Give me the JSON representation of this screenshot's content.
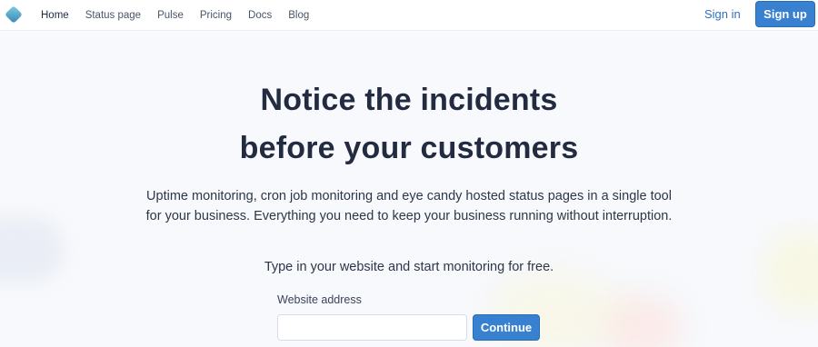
{
  "nav": {
    "links": [
      {
        "label": "Home"
      },
      {
        "label": "Status page"
      },
      {
        "label": "Pulse"
      },
      {
        "label": "Pricing"
      },
      {
        "label": "Docs"
      },
      {
        "label": "Blog"
      }
    ],
    "sign_in": "Sign in",
    "sign_up": "Sign up"
  },
  "hero": {
    "title_line1": "Notice the incidents",
    "title_line2": "before your customers",
    "description": "Uptime monitoring, cron job monitoring and eye candy hosted status pages in a single tool for your business. Everything you need to keep your business running without interruption.",
    "cta_text": "Type in your website and start monitoring for free."
  },
  "form": {
    "label": "Website address",
    "value": "",
    "placeholder": "",
    "submit": "Continue"
  },
  "colors": {
    "accent": "#3880d0",
    "logo_light": "#6fc3d8",
    "logo_dark": "#3b8fb8"
  },
  "icons": {
    "logo": "diamond-logo-icon"
  }
}
